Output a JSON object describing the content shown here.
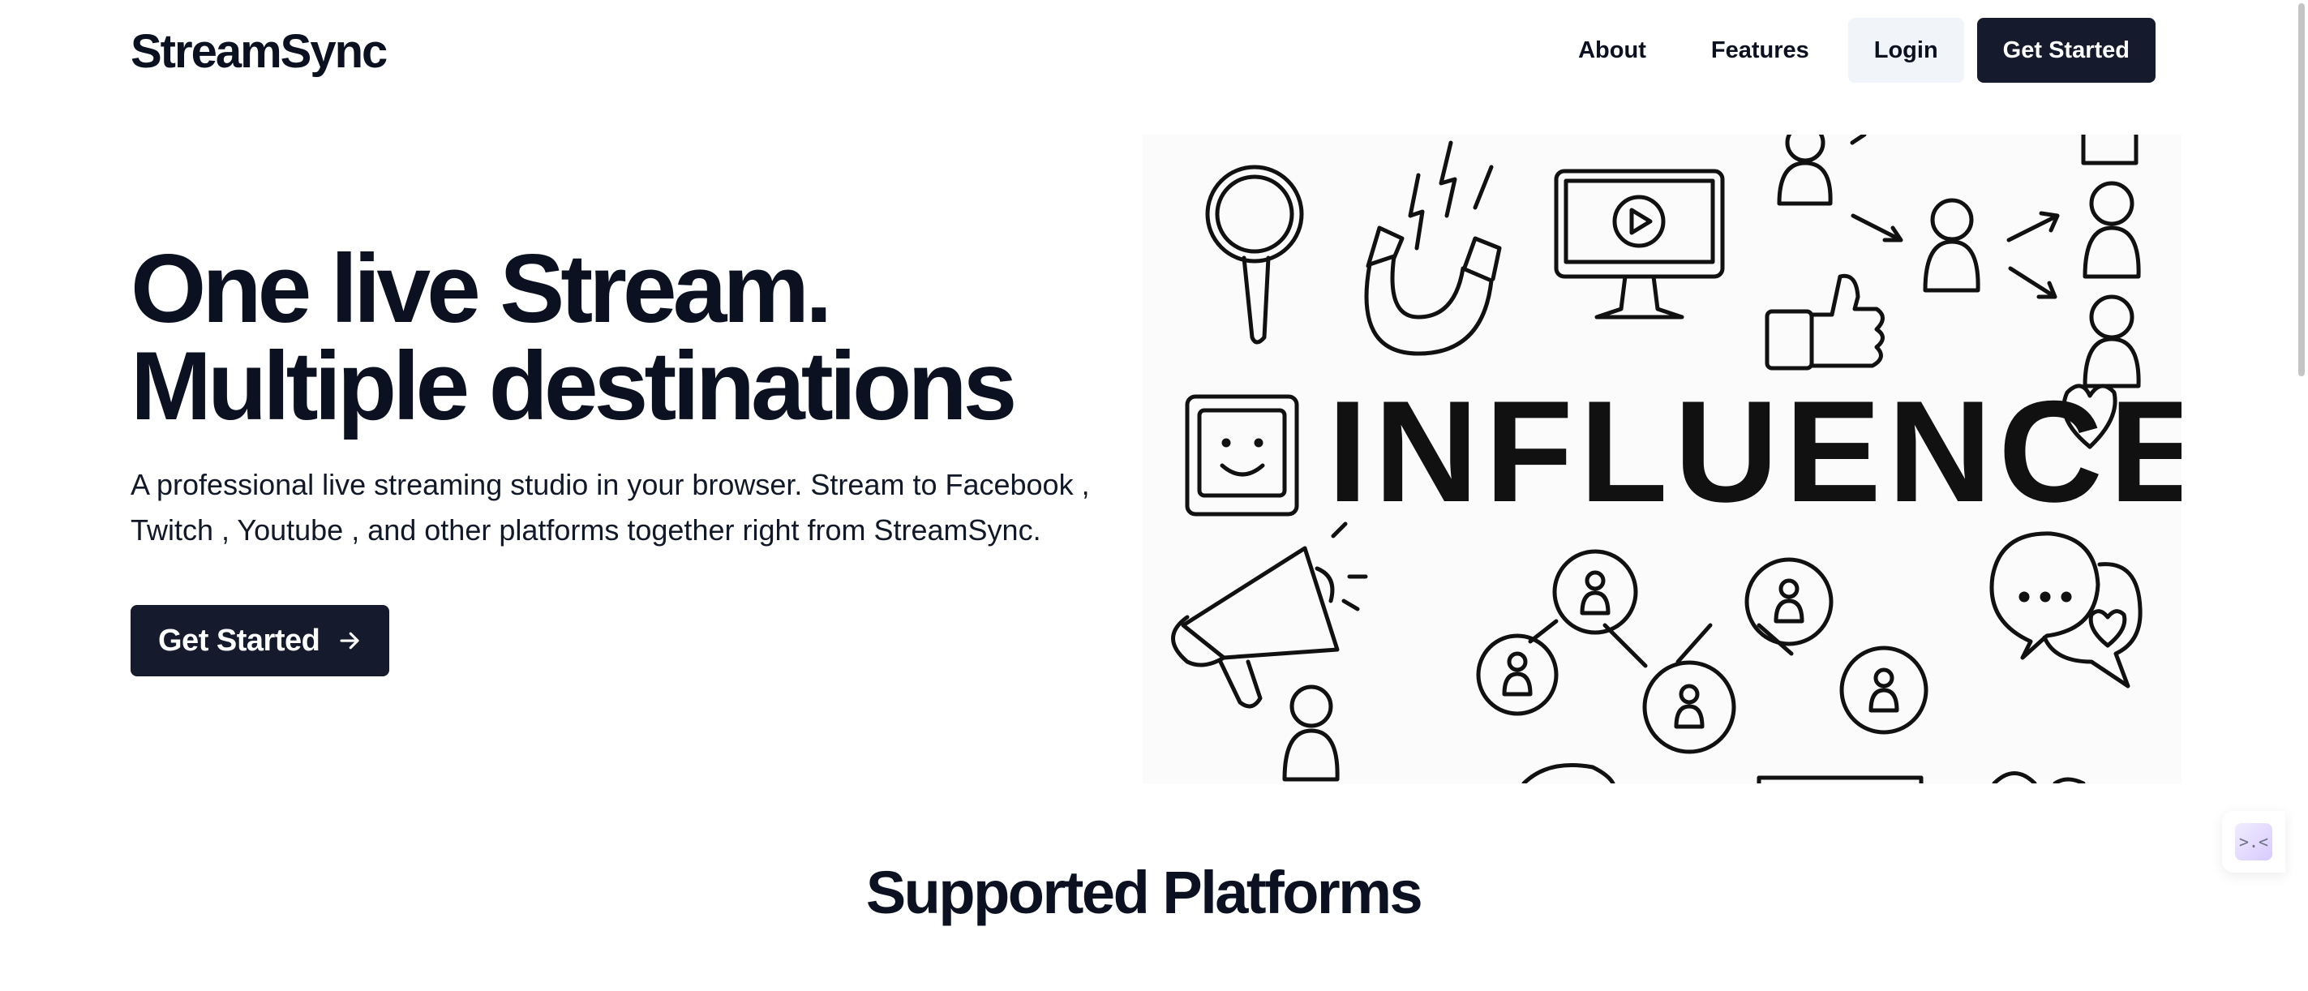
{
  "header": {
    "logo": "StreamSync",
    "nav": {
      "about": "About",
      "features": "Features",
      "login": "Login",
      "get_started": "Get Started"
    }
  },
  "hero": {
    "title_line1": "One live Stream.",
    "title_line2": "Multiple destinations",
    "description": "A professional live streaming studio in your browser. Stream to Facebook , Twitch , Youtube , and other platforms together right from StreamSync.",
    "cta": "Get Started",
    "cta_icon": "arrow-right-icon",
    "illustration_text": "INFLUENCER"
  },
  "platforms": {
    "title": "Supported Platforms"
  },
  "widget": {
    "icon": "chat-widget-icon",
    "glyph": ">.<"
  },
  "colors": {
    "primary": "#151b2d",
    "secondary_button_bg": "#f1f5f9",
    "text": "#0b1120"
  }
}
